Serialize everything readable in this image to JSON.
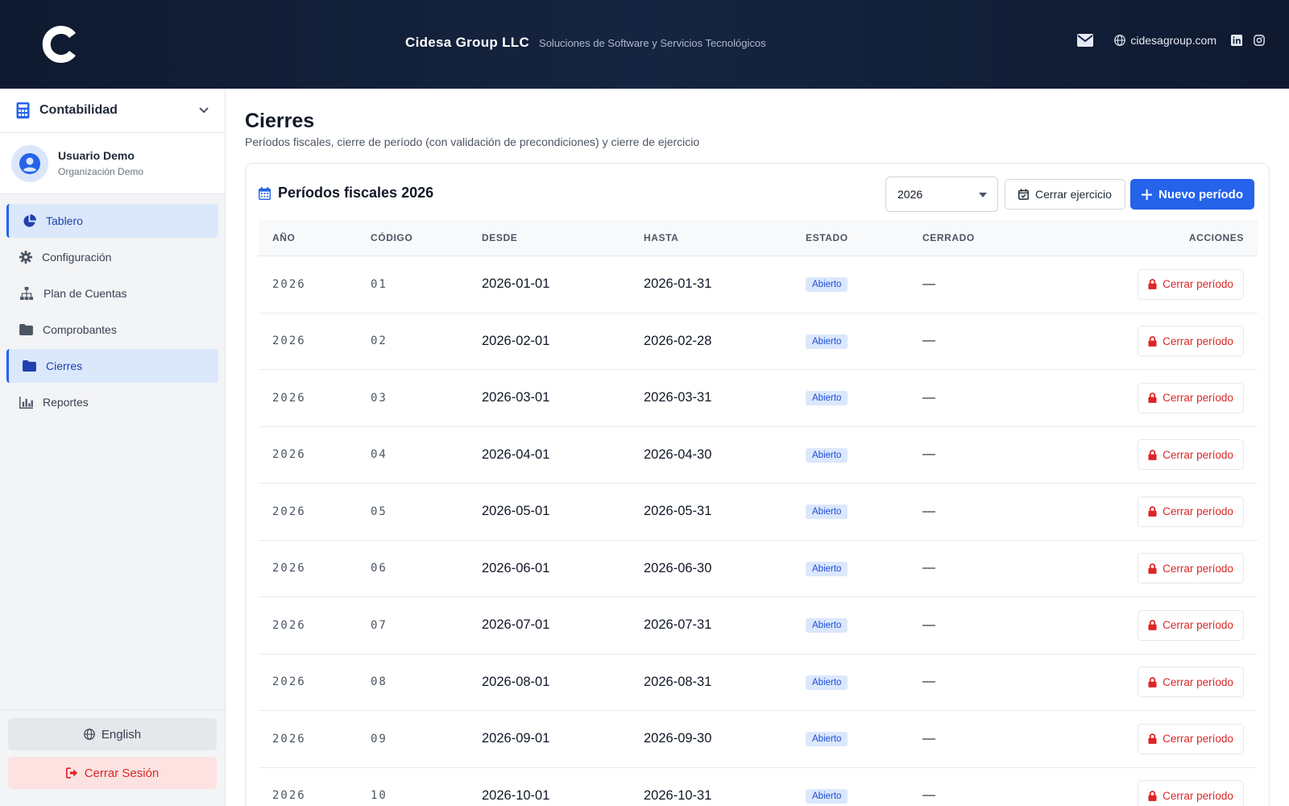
{
  "header": {
    "brand_name": "Cidesa Group LLC",
    "brand_tagline": "Soluciones de Software y Servicios Tecnológicos",
    "website": "cidesagroup.com"
  },
  "sidebar": {
    "module": "Contabilidad",
    "user_name": "Usuario Demo",
    "user_org": "Organización Demo",
    "items": [
      {
        "label": "Tablero",
        "icon": "pie-chart-icon",
        "active": true
      },
      {
        "label": "Configuración",
        "icon": "gear-icon",
        "active": false
      },
      {
        "label": "Plan de Cuentas",
        "icon": "sitemap-icon",
        "active": false
      },
      {
        "label": "Comprobantes",
        "icon": "folder-icon",
        "active": false
      },
      {
        "label": "Cierres",
        "icon": "folder-open-icon",
        "active": true
      },
      {
        "label": "Reportes",
        "icon": "bar-chart-icon",
        "active": false
      }
    ],
    "language_label": "English",
    "logout_label": "Cerrar Sesión"
  },
  "main": {
    "title": "Cierres",
    "subtitle": "Períodos fiscales, cierre de período (con validación de precondiciones) y cierre de ejercicio",
    "card_title": "Períodos fiscales 2026",
    "year_selected": "2026",
    "close_year_label": "Cerrar ejercicio",
    "new_period_label": "Nuevo período",
    "columns": [
      "AÑO",
      "CÓDIGO",
      "DESDE",
      "HASTA",
      "ESTADO",
      "CERRADO",
      "ACCIONES"
    ],
    "rows": [
      {
        "anio": "2026",
        "codigo": "01",
        "desde": "2026-01-01",
        "hasta": "2026-01-31",
        "estado": "Abierto",
        "cerrado": "—",
        "accion": "Cerrar período"
      },
      {
        "anio": "2026",
        "codigo": "02",
        "desde": "2026-02-01",
        "hasta": "2026-02-28",
        "estado": "Abierto",
        "cerrado": "—",
        "accion": "Cerrar período"
      },
      {
        "anio": "2026",
        "codigo": "03",
        "desde": "2026-03-01",
        "hasta": "2026-03-31",
        "estado": "Abierto",
        "cerrado": "—",
        "accion": "Cerrar período"
      },
      {
        "anio": "2026",
        "codigo": "04",
        "desde": "2026-04-01",
        "hasta": "2026-04-30",
        "estado": "Abierto",
        "cerrado": "—",
        "accion": "Cerrar período"
      },
      {
        "anio": "2026",
        "codigo": "05",
        "desde": "2026-05-01",
        "hasta": "2026-05-31",
        "estado": "Abierto",
        "cerrado": "—",
        "accion": "Cerrar período"
      },
      {
        "anio": "2026",
        "codigo": "06",
        "desde": "2026-06-01",
        "hasta": "2026-06-30",
        "estado": "Abierto",
        "cerrado": "—",
        "accion": "Cerrar período"
      },
      {
        "anio": "2026",
        "codigo": "07",
        "desde": "2026-07-01",
        "hasta": "2026-07-31",
        "estado": "Abierto",
        "cerrado": "—",
        "accion": "Cerrar período"
      },
      {
        "anio": "2026",
        "codigo": "08",
        "desde": "2026-08-01",
        "hasta": "2026-08-31",
        "estado": "Abierto",
        "cerrado": "—",
        "accion": "Cerrar período"
      },
      {
        "anio": "2026",
        "codigo": "09",
        "desde": "2026-09-01",
        "hasta": "2026-09-30",
        "estado": "Abierto",
        "cerrado": "—",
        "accion": "Cerrar período"
      },
      {
        "anio": "2026",
        "codigo": "10",
        "desde": "2026-10-01",
        "hasta": "2026-10-31",
        "estado": "Abierto",
        "cerrado": "—",
        "accion": "Cerrar período"
      }
    ]
  },
  "colors": {
    "header_bg": "#0f1a30",
    "accent": "#2563eb",
    "danger": "#dc2626",
    "badge_bg": "#dbe7fb"
  }
}
